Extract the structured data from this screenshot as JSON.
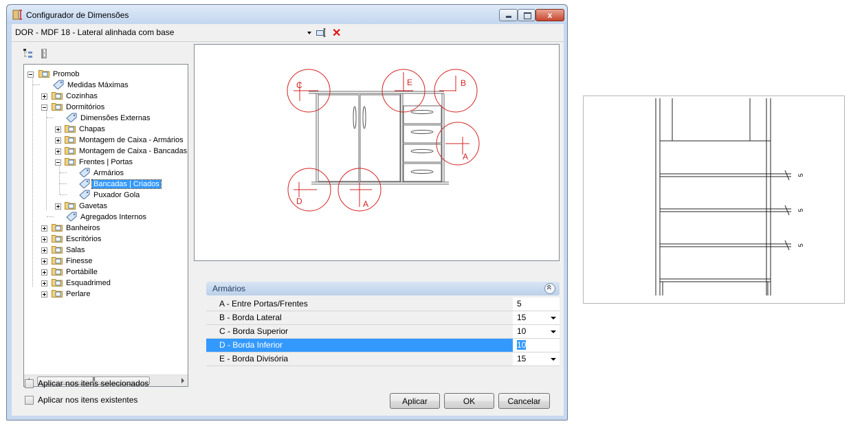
{
  "window": {
    "title": "Configurador de Dimensões",
    "close_glyph": "x"
  },
  "combo": {
    "value": "DOR - MDF 18 - Lateral alinhada com base",
    "delete_glyph": "✕"
  },
  "tree": {
    "items": [
      {
        "label": "Promob",
        "icon": "folder-icon"
      },
      {
        "label": "Medidas Máximas",
        "icon": "tag-icon"
      },
      {
        "label": "Cozinhas",
        "icon": "folder-icon"
      },
      {
        "label": "Dormitórios",
        "icon": "folder-icon"
      },
      {
        "label": "Dimensões Externas",
        "icon": "tag-icon"
      },
      {
        "label": "Chapas",
        "icon": "folder-icon"
      },
      {
        "label": "Montagem de Caixa - Armários",
        "icon": "folder-icon"
      },
      {
        "label": "Montagem de Caixa - Bancadas",
        "icon": "folder-icon"
      },
      {
        "label": "Frentes | Portas",
        "icon": "folder-icon"
      },
      {
        "label": "Armários",
        "icon": "tag-icon"
      },
      {
        "label": "Bancadas | Criados",
        "icon": "tag-icon"
      },
      {
        "label": "Puxador Gola",
        "icon": "tag-icon"
      },
      {
        "label": "Gavetas",
        "icon": "folder-icon"
      },
      {
        "label": "Agregados Internos",
        "icon": "tag-icon"
      },
      {
        "label": "Banheiros",
        "icon": "folder-icon"
      },
      {
        "label": "Escritórios",
        "icon": "folder-icon"
      },
      {
        "label": "Salas",
        "icon": "folder-icon"
      },
      {
        "label": "Finesse",
        "icon": "folder-icon"
      },
      {
        "label": "Portábille",
        "icon": "folder-icon"
      },
      {
        "label": "Esquadrimed",
        "icon": "folder-icon"
      },
      {
        "label": "Perlare",
        "icon": "folder-icon"
      }
    ]
  },
  "checkboxes": {
    "selected_label": "Aplicar nos itens selecionados",
    "existing_label": "Aplicar nos itens existentes"
  },
  "preview": {
    "markers": [
      "C",
      "E",
      "B",
      "A",
      "D",
      "A"
    ]
  },
  "property_grid": {
    "category": "Armários",
    "rows": [
      {
        "name": "A - Entre Portas/Frentes",
        "value": "5"
      },
      {
        "name": "B - Borda Lateral",
        "value": "15"
      },
      {
        "name": "C - Borda Superior",
        "value": "10"
      },
      {
        "name": "D - Borda Inferior",
        "value": "10"
      },
      {
        "name": "E - Borda Divisória",
        "value": "15"
      }
    ]
  },
  "buttons": {
    "apply": "Aplicar",
    "ok": "OK",
    "cancel": "Cancelar"
  },
  "side_drawing": {
    "dimension_labels": [
      "5",
      "5",
      "5"
    ]
  },
  "colors": {
    "accent": "#3399ff",
    "marker_red": "#d42020"
  }
}
